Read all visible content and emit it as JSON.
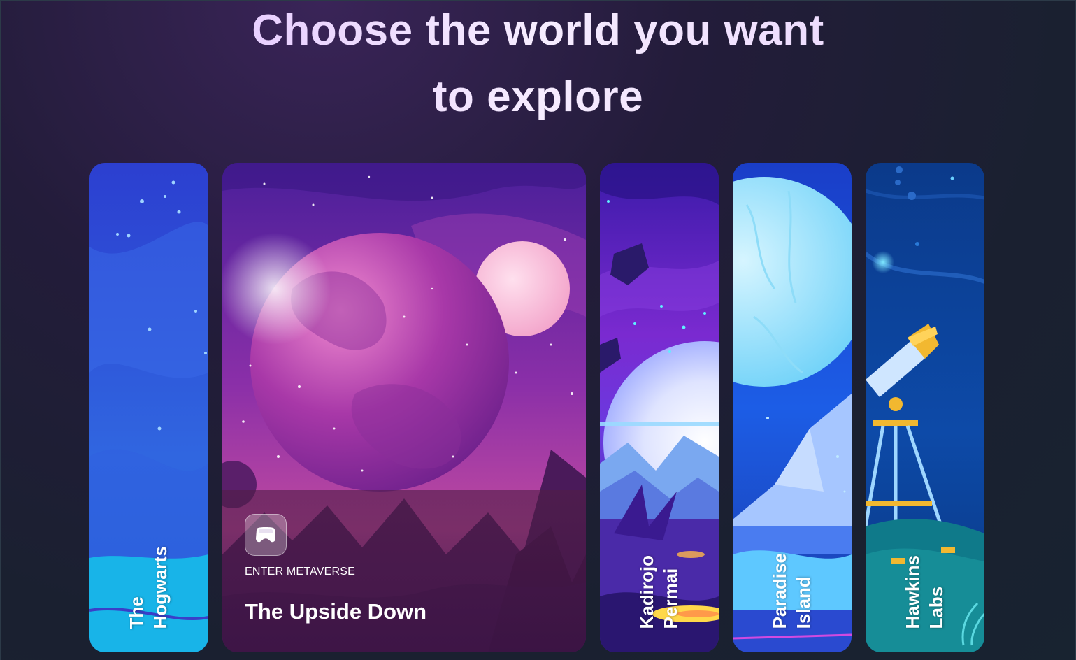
{
  "headline": {
    "line1": "Choose the world you want",
    "line2": "to explore"
  },
  "featured_card": {
    "action_label": "ENTER METAVERSE",
    "title": "The Upside Down",
    "icon": "vr-headset-icon"
  },
  "cards": [
    {
      "line1": "The",
      "line2": "Hogwarts"
    },
    {
      "line1": "Kadirojo",
      "line2": "Permai"
    },
    {
      "line1": "Paradise",
      "line2": "Island"
    },
    {
      "line1": "Hawkins",
      "line2": "Labs"
    }
  ],
  "colors": {
    "headline": "#eedcfb",
    "background": "#1c2233",
    "upside_down_accent": "#b04aa8",
    "hogwarts_accent": "#2a4fd8",
    "kadirojo_accent": "#6a22c8",
    "paradise_accent": "#1c5de6",
    "hawkins_accent": "#0b3e94"
  }
}
